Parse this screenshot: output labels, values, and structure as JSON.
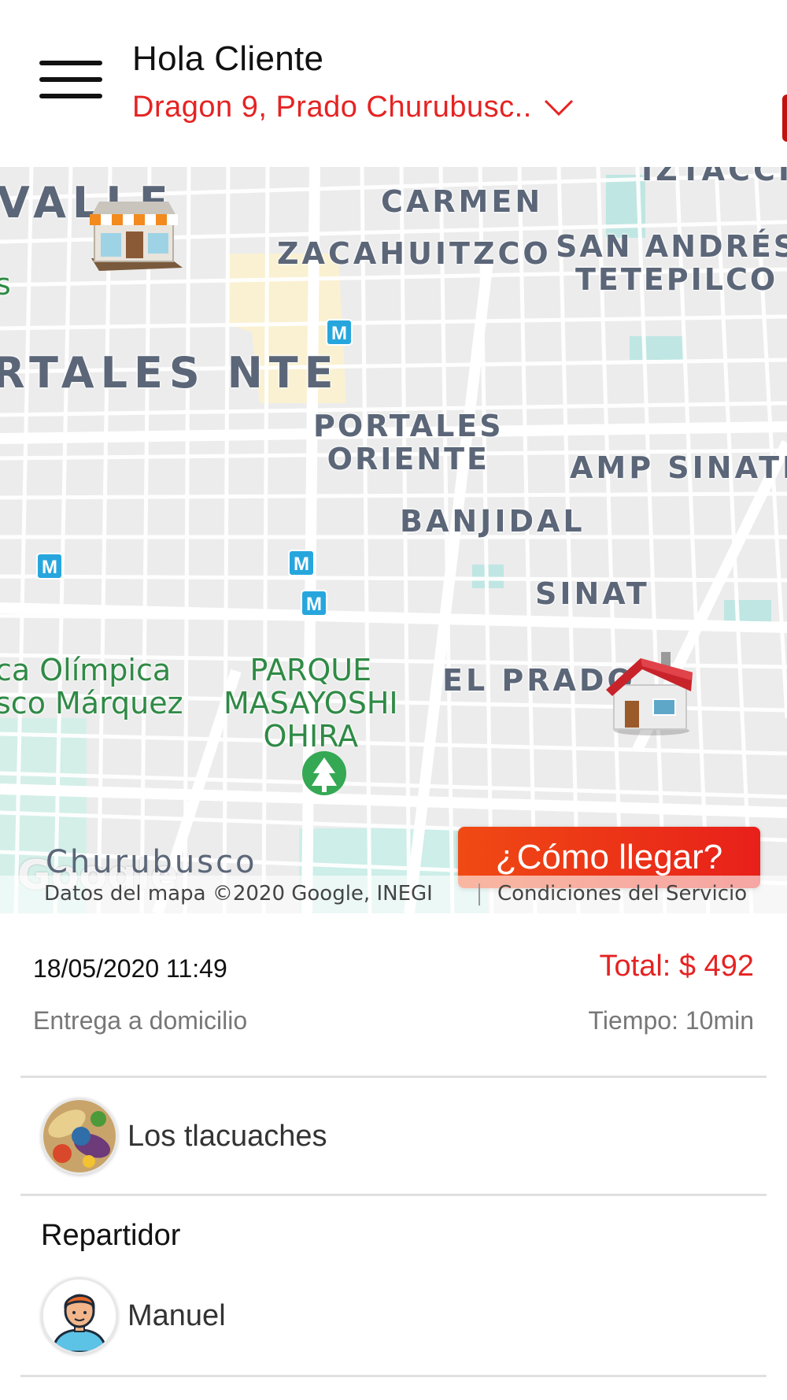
{
  "header": {
    "greeting": "Hola Cliente",
    "address": "Dragon 9, Prado Churubusc..",
    "menu_icon": "hamburger-menu-icon",
    "dropdown_icon": "chevron-down-icon",
    "accent_color": "#e52323"
  },
  "map": {
    "neighborhoods": {
      "valle": "VALLE",
      "carmen": "CARMEN",
      "zacahuitzco": "ZACAHUITZCO",
      "san_andres": "SAN ANDRÉS",
      "tetepilco": "TETEPILCO",
      "portales_nte": "RTALES NTE",
      "portales_oriente_1": "PORTALES",
      "portales_oriente_2": "ORIENTE",
      "amp_sinatel": "AMP SINATE",
      "banjidal": "BANJIDAL",
      "sinatel": "SINAT",
      "el_prado": "EL PRADO",
      "iztacci": "IZTACCI",
      "churubusco": "Churubusco"
    },
    "parks": {
      "ciudad_deportiva_1": "ca Olímpica",
      "ciudad_deportiva_2": "sco Márquez",
      "parque_1": "PARQUE",
      "parque_2": "MASAYOSHI",
      "parque_3": "OHIRA",
      "edge_s": "s"
    },
    "metro_label": "M",
    "google_logo": "Google",
    "attribution_data": "Datos del mapa ©2020 Google, INEGI",
    "attribution_terms": "Condiciones del Servicio",
    "directions_button": "¿Cómo llegar?",
    "store_marker_icon": "store-marker-icon",
    "home_marker_icon": "home-marker-icon"
  },
  "order": {
    "datetime": "18/05/2020 11:49",
    "total": "Total: $ 492",
    "service_type": "Entrega a domicilio",
    "eta": "Tiempo: 10min"
  },
  "restaurant": {
    "name": "Los tlacuaches",
    "avatar_icon": "restaurant-food-avatar"
  },
  "courier": {
    "heading": "Repartidor",
    "name": "Manuel",
    "avatar_icon": "courier-avatar"
  }
}
